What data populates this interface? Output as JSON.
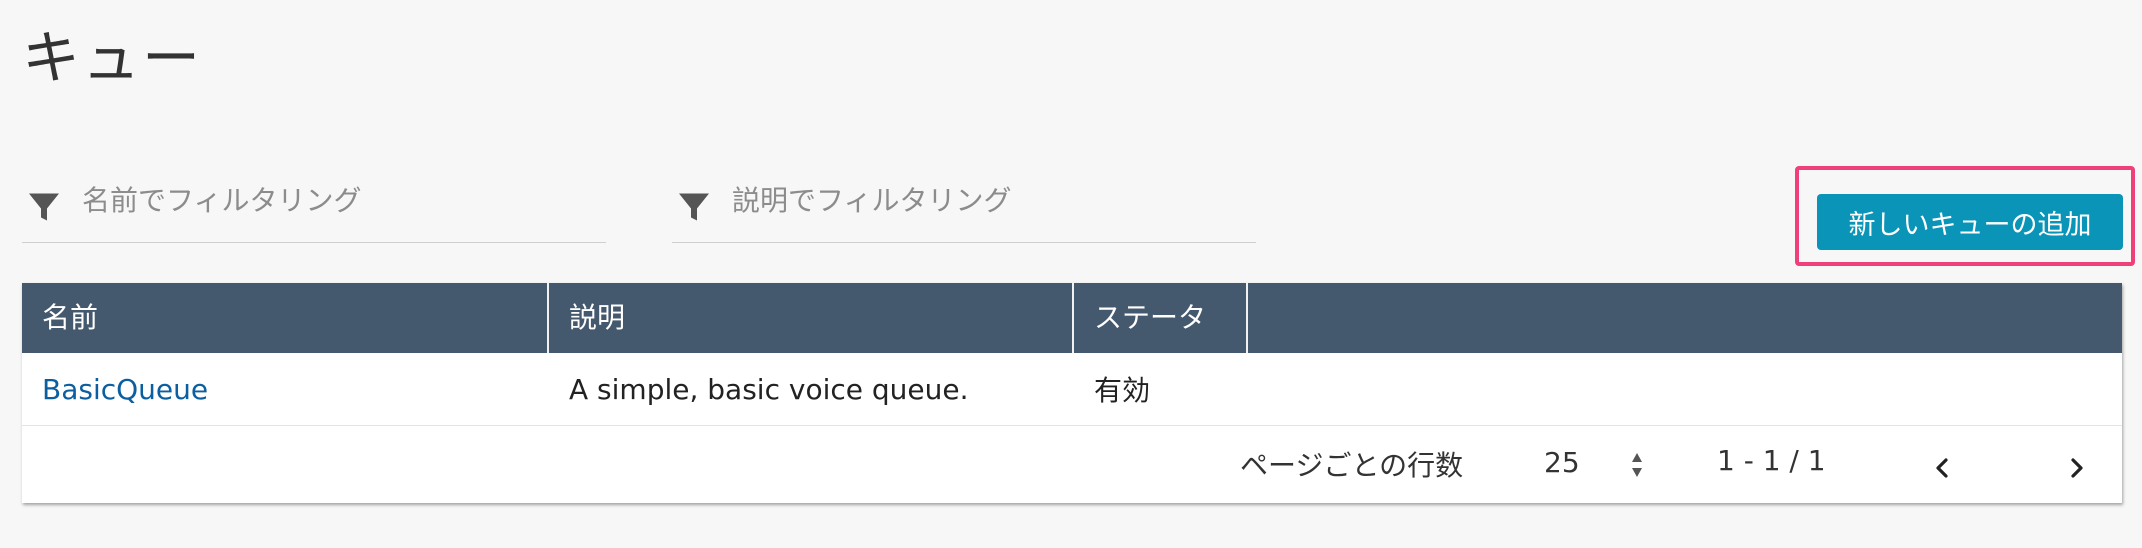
{
  "page": {
    "title": "キュー"
  },
  "filters": {
    "name_placeholder": "名前でフィルタリング",
    "description_placeholder": "説明でフィルタリング"
  },
  "actions": {
    "add_queue_label": "新しいキューの追加"
  },
  "table": {
    "columns": [
      "名前",
      "説明",
      "ステータ",
      ""
    ],
    "rows": [
      {
        "name": "BasicQueue",
        "description": "A simple, basic voice queue.",
        "status": "有効"
      }
    ]
  },
  "pagination": {
    "rows_per_page_label": "ページごとの行数",
    "rows_per_page_value": "25",
    "range_text": "1 - 1 / 1"
  },
  "colors": {
    "header_bg": "#44586e",
    "button_bg": "#0a94b8",
    "highlight_border": "#f0407c",
    "link": "#0b5fa0"
  },
  "icons": {
    "filter": "funnel-icon",
    "stepper": "sort-stepper-icon",
    "prev": "chevron-left-icon",
    "next": "chevron-right-icon"
  }
}
